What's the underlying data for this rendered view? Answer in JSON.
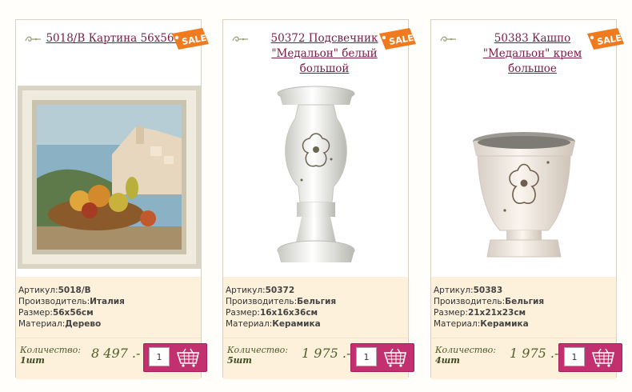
{
  "products": [
    {
      "title": "5018/B Картина 56х56см",
      "sale_label": "SALE",
      "article_label": "Артикул:",
      "article": "5018/B",
      "maker_label": "Производитель:",
      "maker": "Италия",
      "size_label": "Размер:",
      "size": "56х56см",
      "material_label": "Материал:",
      "material": "Дерево",
      "quantity_label": "Количество:",
      "quantity": "1шт",
      "price": "8 497 .-",
      "qty_value": "1",
      "image_icon": "framed-painting-image"
    },
    {
      "title": "50372 Подсвечник \"Медальон\" белый большой",
      "sale_label": "SALE",
      "article_label": "Артикул:",
      "article": "50372",
      "maker_label": "Производитель:",
      "maker": "Бельгия",
      "size_label": "Размер:",
      "size": "16х16х36см",
      "material_label": "Материал:",
      "material": "Керамика",
      "quantity_label": "Количество:",
      "quantity": "5шт",
      "price": "1 975 .-",
      "qty_value": "1",
      "image_icon": "candlestick-image"
    },
    {
      "title": "50383 Кашпо \"Медальон\" крем большое",
      "sale_label": "SALE",
      "article_label": "Артикул:",
      "article": "50383",
      "maker_label": "Производитель:",
      "maker": "Бельгия",
      "size_label": "Размер:",
      "size": "21х21х23см",
      "material_label": "Материал:",
      "material": "Керамика",
      "quantity_label": "Количество:",
      "quantity": "4шт",
      "price": "1 975 .-",
      "qty_value": "1",
      "image_icon": "planter-pot-image"
    }
  ],
  "colors": {
    "title": "#7b1a44",
    "sale_tag": "#f07a1e",
    "info_bg": "#fdf1dc",
    "cart_button": "#c2306f",
    "price": "#4f5e2a"
  },
  "icons": [
    "ornament-icon",
    "sale-tag-icon",
    "cart-icon"
  ]
}
